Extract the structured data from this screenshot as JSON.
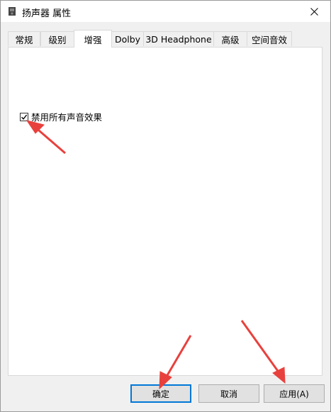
{
  "window": {
    "title": "扬声器 属性"
  },
  "tabs": [
    {
      "label": "常规"
    },
    {
      "label": "级别"
    },
    {
      "label": "增强"
    },
    {
      "label": "Dolby"
    },
    {
      "label": "3D Headphone"
    },
    {
      "label": "高级"
    },
    {
      "label": "空间音效"
    }
  ],
  "active_tab": "增强",
  "enhancements": {
    "disable_all_label": "禁用所有声音效果",
    "disable_all_checked": true
  },
  "buttons": {
    "ok_label": "确定",
    "cancel_label": "取消",
    "apply_label": "应用(A)"
  },
  "annotation_color": "#e8413d",
  "icons": {
    "app": "speaker-icon",
    "close": "close-icon",
    "check": "checkmark-icon"
  }
}
